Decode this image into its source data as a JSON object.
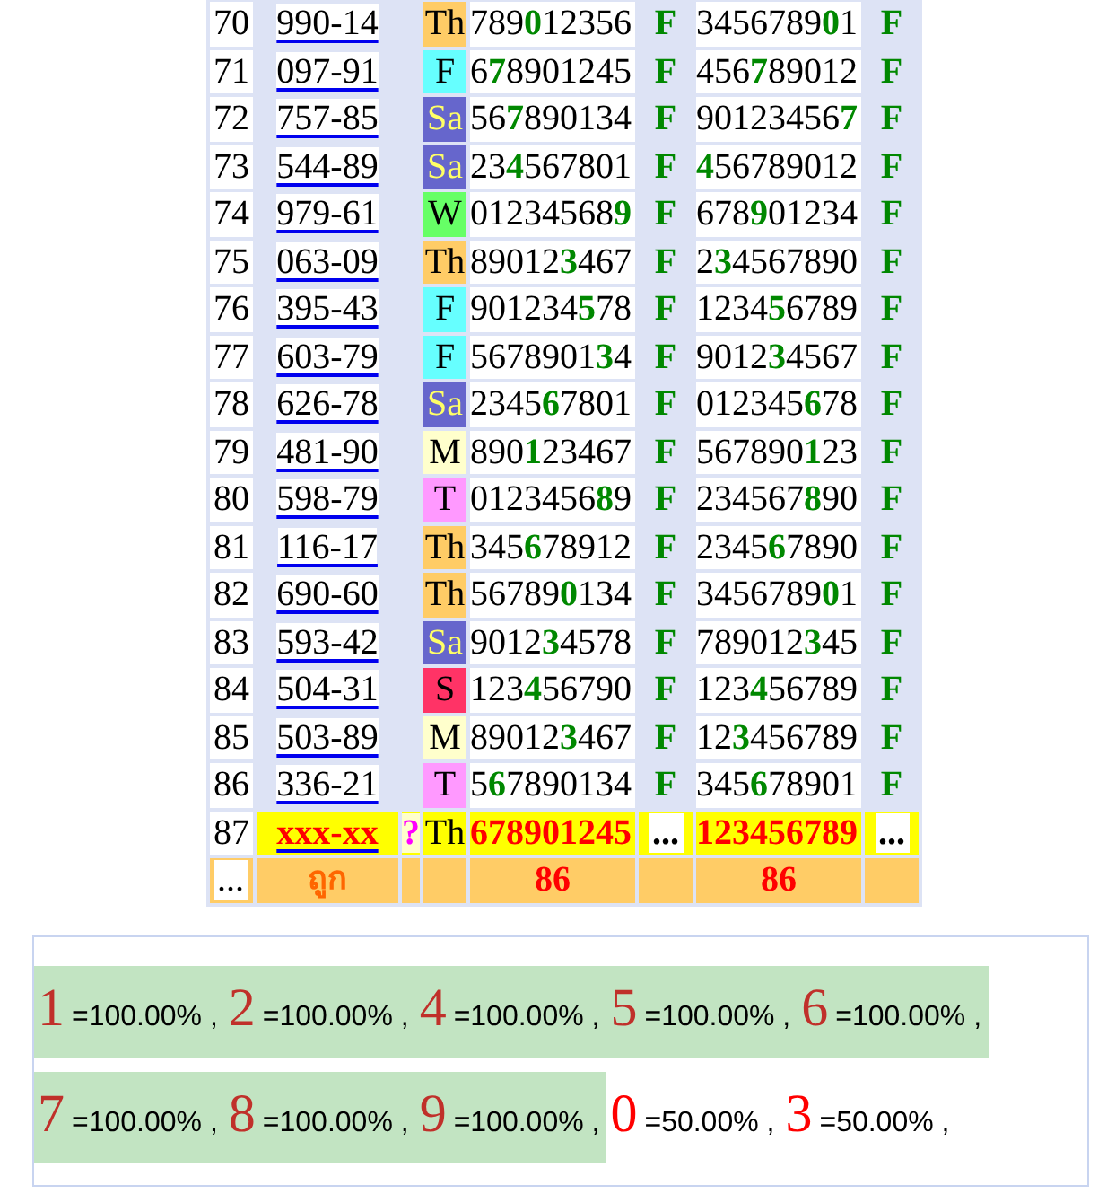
{
  "rows": [
    {
      "kind": "result",
      "number": "70",
      "code": "990-14",
      "day": "Th",
      "color": "#ffcc66",
      "digits_1": "789**0**12356",
      "result_1": "F",
      "digits_2": "3456789**0**1",
      "result_2": "F"
    },
    {
      "kind": "result",
      "number": "71",
      "code": "097-91",
      "day": "F",
      "color": "#66ffff",
      "digits_1": "6**7**8901245",
      "result_1": "F",
      "digits_2": "456**7**89012",
      "result_2": "F"
    },
    {
      "kind": "result",
      "number": "72",
      "code": "757-85",
      "day": "Sa",
      "color": "#6666cc",
      "digits_1": "56**7**890134",
      "result_1": "F",
      "digits_2": "90123456**7**",
      "result_2": "F"
    },
    {
      "kind": "result",
      "number": "73",
      "code": "544-89",
      "day": "Sa",
      "color": "#6666cc",
      "digits_1": "23**4**567801",
      "result_1": "F",
      "digits_2": "**4**56789012",
      "result_2": "F"
    },
    {
      "kind": "result",
      "number": "74",
      "code": "979-61",
      "day": "W",
      "color": "#66ff66",
      "digits_1": "01234568**9**",
      "result_1": "F",
      "digits_2": "678**9**01234",
      "result_2": "F"
    },
    {
      "kind": "result",
      "number": "75",
      "code": "063-09",
      "day": "Th",
      "color": "#ffcc66",
      "digits_1": "89012**3**467",
      "result_1": "F",
      "digits_2": "2**3**4567890",
      "result_2": "F"
    },
    {
      "kind": "result",
      "number": "76",
      "code": "395-43",
      "day": "F",
      "color": "#66ffff",
      "digits_1": "901234**5**78",
      "result_1": "F",
      "digits_2": "1234**5**6789",
      "result_2": "F"
    },
    {
      "kind": "result",
      "number": "77",
      "code": "603-79",
      "day": "F",
      "color": "#66ffff",
      "digits_1": "5678901**3**4",
      "result_1": "F",
      "digits_2": "9012**3**4567",
      "result_2": "F"
    },
    {
      "kind": "result",
      "number": "78",
      "code": "626-78",
      "day": "Sa",
      "color": "#6666cc",
      "digits_1": "2345**6**7801",
      "result_1": "F",
      "digits_2": "012345**6**78",
      "result_2": "F"
    },
    {
      "kind": "result",
      "number": "79",
      "code": "481-90",
      "day": "M",
      "color": "#ffffcc",
      "digits_1": "890**1**23467",
      "result_1": "F",
      "digits_2": "567890**1**23",
      "result_2": "F"
    },
    {
      "kind": "result",
      "number": "80",
      "code": "598-79",
      "day": "T",
      "color": "#ff99ff",
      "digits_1": "0123456**8**9",
      "result_1": "F",
      "digits_2": "234567**8**90",
      "result_2": "F"
    },
    {
      "kind": "result",
      "number": "81",
      "code": "116-17",
      "day": "Th",
      "color": "#ffcc66",
      "digits_1": "345**6**78912",
      "result_1": "F",
      "digits_2": "2345**6**7890",
      "result_2": "F"
    },
    {
      "kind": "result",
      "number": "82",
      "code": "690-60",
      "day": "Th",
      "color": "#ffcc66",
      "digits_1": "56789**0**134",
      "result_1": "F",
      "digits_2": "3456789**0**1",
      "result_2": "F"
    },
    {
      "kind": "result",
      "number": "83",
      "code": "593-42",
      "day": "Sa",
      "color": "#6666cc",
      "digits_1": "9012**3**4578",
      "result_1": "F",
      "digits_2": "789012**3**45",
      "result_2": "F"
    },
    {
      "kind": "result",
      "number": "84",
      "code": "504-31",
      "day": "S",
      "color": "#ff3366",
      "digits_1": "123**4**56790",
      "result_1": "F",
      "digits_2": "123**4**56789",
      "result_2": "F"
    },
    {
      "kind": "result",
      "number": "85",
      "code": "503-89",
      "day": "M",
      "color": "#ffffcc",
      "digits_1": "89012**3**467",
      "result_1": "F",
      "digits_2": "12**3**456789",
      "result_2": "F"
    },
    {
      "kind": "result",
      "number": "86",
      "code": "336-21",
      "day": "T",
      "color": "#ff99ff",
      "digits_1": "5**6**7890134",
      "result_1": "F",
      "digits_2": "345**6**78901",
      "result_2": "F"
    },
    {
      "kind": "pending",
      "number": "87",
      "code": "xxx-xx",
      "mark": "?",
      "day": "Th",
      "color": "#ffff00",
      "digits_1": "678901245",
      "result_1": "...",
      "digits_2": "123456789",
      "result_2": "..."
    }
  ],
  "footer": {
    "first": "...",
    "label": "ถูก",
    "count_1": "86",
    "count_2": "86"
  },
  "stats": [
    {
      "digit": "1",
      "text": "=100.00% ,",
      "highlighted": true
    },
    {
      "digit": "2",
      "text": "=100.00% ,",
      "highlighted": true
    },
    {
      "digit": "4",
      "text": "=100.00% ,",
      "highlighted": true
    },
    {
      "digit": "5",
      "text": "=100.00% ,",
      "highlighted": true
    },
    {
      "digit": "6",
      "text": "=100.00% ,",
      "highlighted": true
    },
    {
      "digit": "7",
      "text": "=100.00% ,",
      "highlighted": true
    },
    {
      "digit": "8",
      "text": "=100.00% ,",
      "highlighted": true
    },
    {
      "digit": "9",
      "text": "=100.00% ,",
      "highlighted": true
    },
    {
      "digit": "0",
      "text": "=50.00% ,",
      "highlighted": false
    },
    {
      "digit": "3",
      "text": "=50.00% ,",
      "highlighted": false
    }
  ]
}
